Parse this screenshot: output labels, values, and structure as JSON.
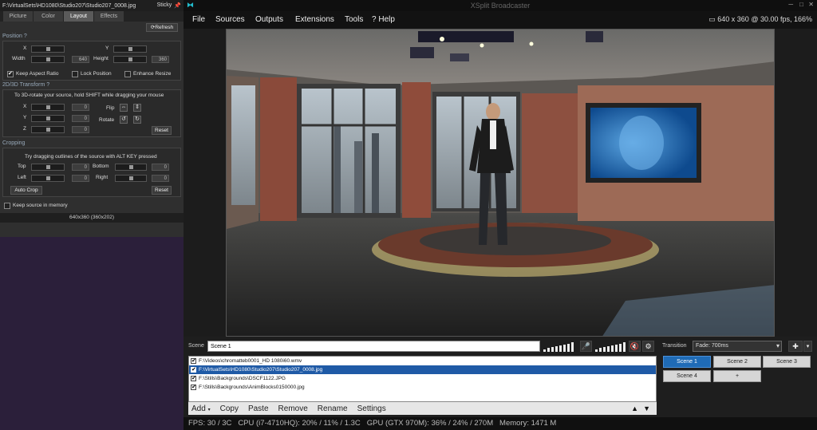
{
  "left_panel": {
    "title": "F:\\VirtualSets\\HD1080\\Studio207\\Studio207_0008.jpg",
    "sticky": "Sticky",
    "tabs": [
      "Picture",
      "Color",
      "Layout",
      "Effects"
    ],
    "refresh": "Refresh",
    "position": {
      "header": "Position",
      "x": "X",
      "y": "Y",
      "width": "Width",
      "height": "Height",
      "width_value": "640",
      "height_value": "360",
      "keep_aspect": "Keep Aspect Ratio",
      "lock_position": "Lock Position",
      "enhance_resize": "Enhance Resize"
    },
    "transform": {
      "header": "2D/3D Transform",
      "hint": "To 3D-rotate your source, hold SHIFT while dragging your mouse",
      "x": "X",
      "y": "Y",
      "z": "Z",
      "x_value": "0",
      "y_value": "0",
      "z_value": "0",
      "flip": "Flip",
      "rotate": "Rotate",
      "reset": "Reset"
    },
    "cropping": {
      "header": "Cropping",
      "hint": "Try dragging outlines of the source with ALT KEY pressed",
      "top": "Top",
      "bottom": "Bottom",
      "left": "Left",
      "right": "Right",
      "top_value": "0",
      "bottom_value": "0",
      "left_value": "0",
      "right_value": "0",
      "auto_crop": "Auto Crop",
      "reset": "Reset"
    },
    "keep_memory": "Keep source in memory",
    "dims": "640x360 (360x202)"
  },
  "app": {
    "title": "XSplit Broadcaster"
  },
  "menu": [
    "File",
    "Sources",
    "Outputs",
    "Extensions",
    "Tools",
    "Help"
  ],
  "resolution": "640 x 360 @ 30.00 fps, 166%",
  "scene": {
    "label": "Scene",
    "value": "Scene 1"
  },
  "sources": [
    "F:\\Videos\\chromatteb0001_HD 1080i60.wmv",
    "F:\\VirtualSets\\HD1080\\Studio207\\Studio207_0008.jpg",
    "F:\\Stills\\Backgrounds\\DSCF1122.JPG",
    "F:\\Stills\\Backgrounds\\AnimBlocks0150000.jpg"
  ],
  "actions": [
    "Add",
    "Copy",
    "Paste",
    "Remove",
    "Rename",
    "Settings"
  ],
  "transition": {
    "label": "Transition",
    "value": "Fade: 700ms"
  },
  "scenes": [
    "Scene 1",
    "Scene 2",
    "Scene 3",
    "Scene 4",
    "+"
  ],
  "status": {
    "fps": "FPS:  30 / 3C",
    "cpu": "CPU (i7-4710HQ):  20% / 11% / 1.3C",
    "gpu": "GPU (GTX 970M):  36% / 24% / 270M",
    "memory": "Memory:  1471 M"
  }
}
